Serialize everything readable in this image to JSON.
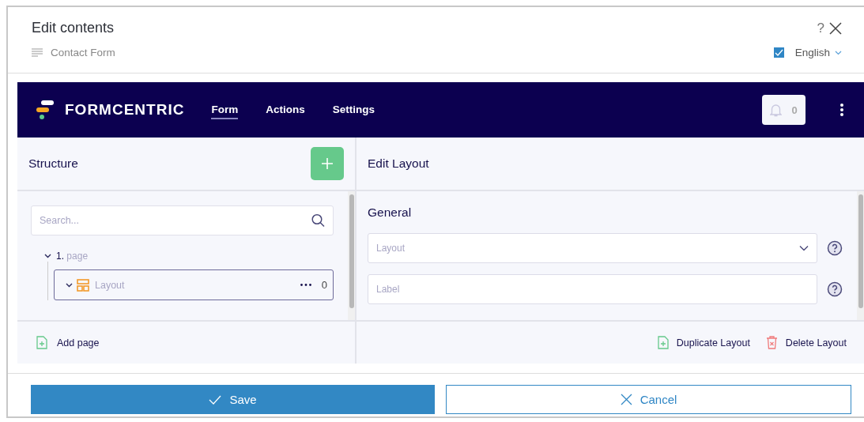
{
  "dialog": {
    "title": "Edit contents",
    "help": "?",
    "subtitle": "Contact Form",
    "language": {
      "checked": true,
      "label": "English"
    }
  },
  "app": {
    "brand": "FORMCENTRIC",
    "nav": [
      {
        "label": "Form",
        "selected": true
      },
      {
        "label": "Actions",
        "selected": false
      },
      {
        "label": "Settings",
        "selected": false
      }
    ],
    "notifications": "0"
  },
  "structure": {
    "title": "Structure",
    "search_placeholder": "Search...",
    "tree": [
      {
        "number": "1.",
        "label": "page",
        "expanded": true,
        "selected": false,
        "children": [
          {
            "label": "Layout",
            "count": "0",
            "expanded": true,
            "selected": true
          }
        ]
      }
    ],
    "footer_action": "Add page"
  },
  "editor": {
    "title": "Edit Layout",
    "section": "General",
    "fields": [
      {
        "kind": "select",
        "placeholder": "Layout"
      },
      {
        "kind": "text",
        "placeholder": "Label"
      }
    ],
    "actions": [
      {
        "kind": "duplicate",
        "label": "Duplicate Layout"
      },
      {
        "kind": "delete",
        "label": "Delete Layout"
      }
    ]
  },
  "buttons": [
    {
      "kind": "primary",
      "label": "Save"
    },
    {
      "kind": "secondary",
      "label": "Cancel"
    }
  ]
}
